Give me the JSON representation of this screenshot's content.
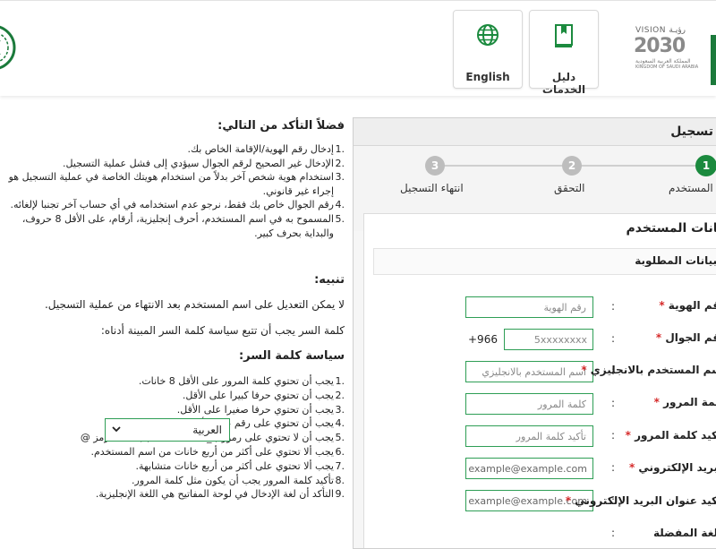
{
  "header": {
    "english_label": "English",
    "guide_label": "دليل الخدمات",
    "vision": {
      "top": "VISION رؤيـة",
      "year": "2030",
      "sub_ar": "المملكة العربية السعودية",
      "sub_en": "KINGDOM OF SAUDI ARABIA"
    }
  },
  "info": {
    "title": "فضلاً التأكد من التالي:",
    "items": [
      "إدخال رقم الهوية/الإقامة الخاص بك.",
      "الإدخال غير الصحيح لرقم الجوال سيؤدي إلى فشل عملية التسجيل.",
      "استخدام هوية شخص آخر بدلاً من استخدام هويتك الخاصة في عملية التسجيل هو إجراء غير قانوني.",
      "رقم الجوال خاص بك فقط، نرجو عدم استخدامه في أي حساب آخر تجنبا لإلغائه.",
      "المسموح به في اسم المستخدم، أحرف إنجليزية، أرقام، على الأقل 8 حروف، والبداية بحرف كبير."
    ],
    "notice_title": "تنبيه:",
    "notice_1": "لا يمكن التعديل على اسم المستخدم بعد الانتهاء من عملية التسجيل.",
    "notice_2": "كلمة السر يجب أن تتبع سياسة كلمة السر المبينة أدناه:",
    "policy_title": "سياسة كلمة السر:",
    "policy": [
      "يجب أن تحتوي كلمة المرور على الأقل 8 خانات.",
      "يجب أن تحتوي حرفا كبيرا على الأقل.",
      "يجب أن تحتوي حرفا صغيرا على الأقل.",
      "يجب أن تحتوي على رقم على الأقل.",
      "يجب أن لا تحتوي على رموز ( _ ، %، ! ، . ... ) باستثناء رمز @",
      "يجب ألا تحتوي على أكثر من أربع خانات من اسم المستخدم.",
      "يجب ألا تحتوي على أكثر من أربع خانات متشابهة.",
      "تأكيد كلمة المرور يجب أن يكون مثل كلمة المرور.",
      "التأكد أن لغة الإدخال في لوحة المفاتيح هي اللغة الإنجليزية."
    ]
  },
  "form": {
    "panel_title": "تسجيل",
    "steps": [
      {
        "num": "1",
        "label": "بيانات المستخدم"
      },
      {
        "num": "2",
        "label": "التحقق"
      },
      {
        "num": "3",
        "label": "انتهاء التسجيل"
      }
    ],
    "title": "بيانات المستخدم",
    "required_note": "البيانات المطلوبة",
    "fields": {
      "id": {
        "label": "رقم الهوية",
        "placeholder": "رقم الهوية"
      },
      "mobile": {
        "label": "رقم الجوال",
        "prefix": "+966",
        "placeholder": "5xxxxxxxx"
      },
      "username": {
        "label": "اسم المستخدم بالانجليزي",
        "placeholder": "اسم المستخدم بالانجليزي"
      },
      "password": {
        "label": "كلمة المرور",
        "placeholder": "كلمة المرور"
      },
      "confirm_password": {
        "label": "تأكيد كلمة المرور",
        "placeholder": "تأكيد كلمة المرور"
      },
      "email": {
        "label": "البريد الإلكتروني",
        "placeholder": "example@example.com"
      },
      "confirm_email": {
        "label": "تأكيد عنوان البريد الإلكتروني",
        "placeholder": "example@example.com"
      },
      "language": {
        "label": "اللغة المفضلة",
        "value": "العربية"
      }
    }
  },
  "colors": {
    "accent": "#1b8a3e",
    "field_border": "#2e9e55",
    "required_star": "#d62b2b"
  }
}
